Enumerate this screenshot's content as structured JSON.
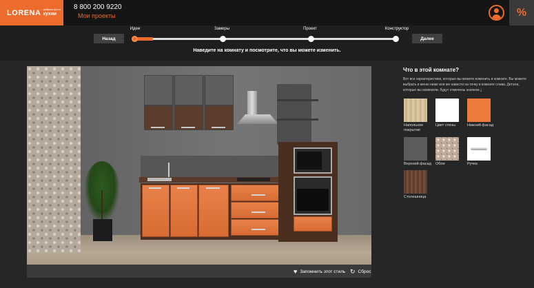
{
  "header": {
    "logo_main": "LORENA",
    "logo_small": "фабрика кухонь",
    "logo_sub": "кухни",
    "phone": "8 800 200 9220",
    "projects_link": "Мои проекты",
    "promo_symbol": "%"
  },
  "steps": {
    "back_label": "Назад",
    "next_label": "Далее",
    "progress": 0.07,
    "items": [
      {
        "label": "Идеи"
      },
      {
        "label": "Замеры"
      },
      {
        "label": "Проект"
      },
      {
        "label": "Конструктор"
      }
    ],
    "instruction": "Наведите на комнату и посмотрите, что вы можете изменить."
  },
  "scene_bar": {
    "remember_label": "Запомнить этот стиль",
    "reset_label": "Сброс"
  },
  "panel": {
    "title": "Что в этой комнате?",
    "description": "Вот все характеристики, которые вы можете изменить в комнате. Вы можете выбрать в меню ниже или же навести на точку в комнате слева. Детали, которые вы изменили, будут отмечены значком",
    "tiles": [
      {
        "label": "Напольное покрытие",
        "label_line2": "покрытие",
        "label_line1": "Напольное"
      },
      {
        "label": "Цвет стены"
      },
      {
        "label": "Нижний фасад"
      },
      {
        "label": "Верхний фасад"
      },
      {
        "label": "Обои"
      },
      {
        "label": "Ручка"
      },
      {
        "label": "Столешница"
      }
    ]
  },
  "colors": {
    "accent": "#ec6b2d",
    "header_bg": "#151515",
    "page_bg": "#262626"
  }
}
